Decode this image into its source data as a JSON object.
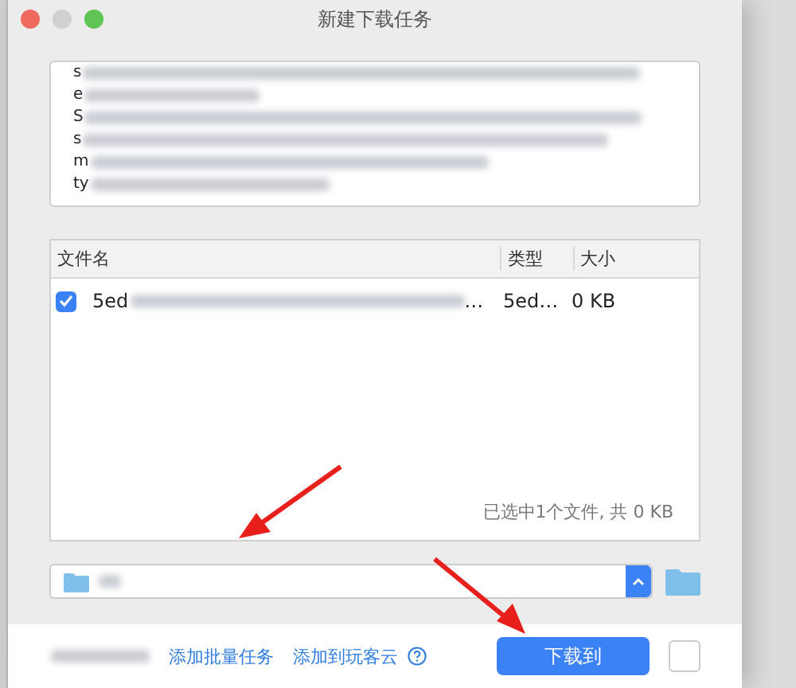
{
  "window": {
    "title": "新建下载任务"
  },
  "url_box": {
    "lines": [
      "s",
      "e",
      "S",
      "s",
      "m",
      "ty"
    ]
  },
  "table": {
    "columns": [
      "文件名",
      "类型",
      "大小"
    ],
    "rows": [
      {
        "checked": true,
        "name_start": "5ed",
        "name_end": "…",
        "type": "5ed…",
        "size": "0 KB"
      }
    ]
  },
  "summary": "已选中1个文件, 共 0 KB",
  "footer": {
    "links": [
      "添加批量任务",
      "添加到玩客云"
    ],
    "download_button": "下载到"
  }
}
